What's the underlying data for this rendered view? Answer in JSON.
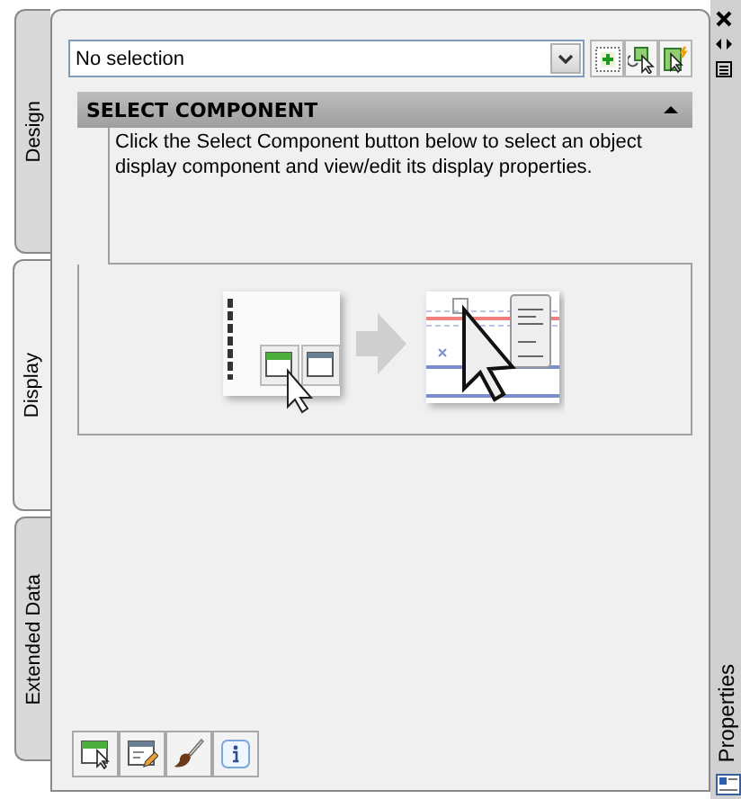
{
  "side_tabs": [
    {
      "label": "Design",
      "selected": false
    },
    {
      "label": "Display",
      "selected": true
    },
    {
      "label": "Extended Data",
      "selected": false
    }
  ],
  "component_select": {
    "value": "No selection"
  },
  "section": {
    "title": "SELECT COMPONENT",
    "expanded": true,
    "description": "Click the Select Component button below to select an object display component and view/edit its display properties."
  },
  "palette_title": "Properties"
}
